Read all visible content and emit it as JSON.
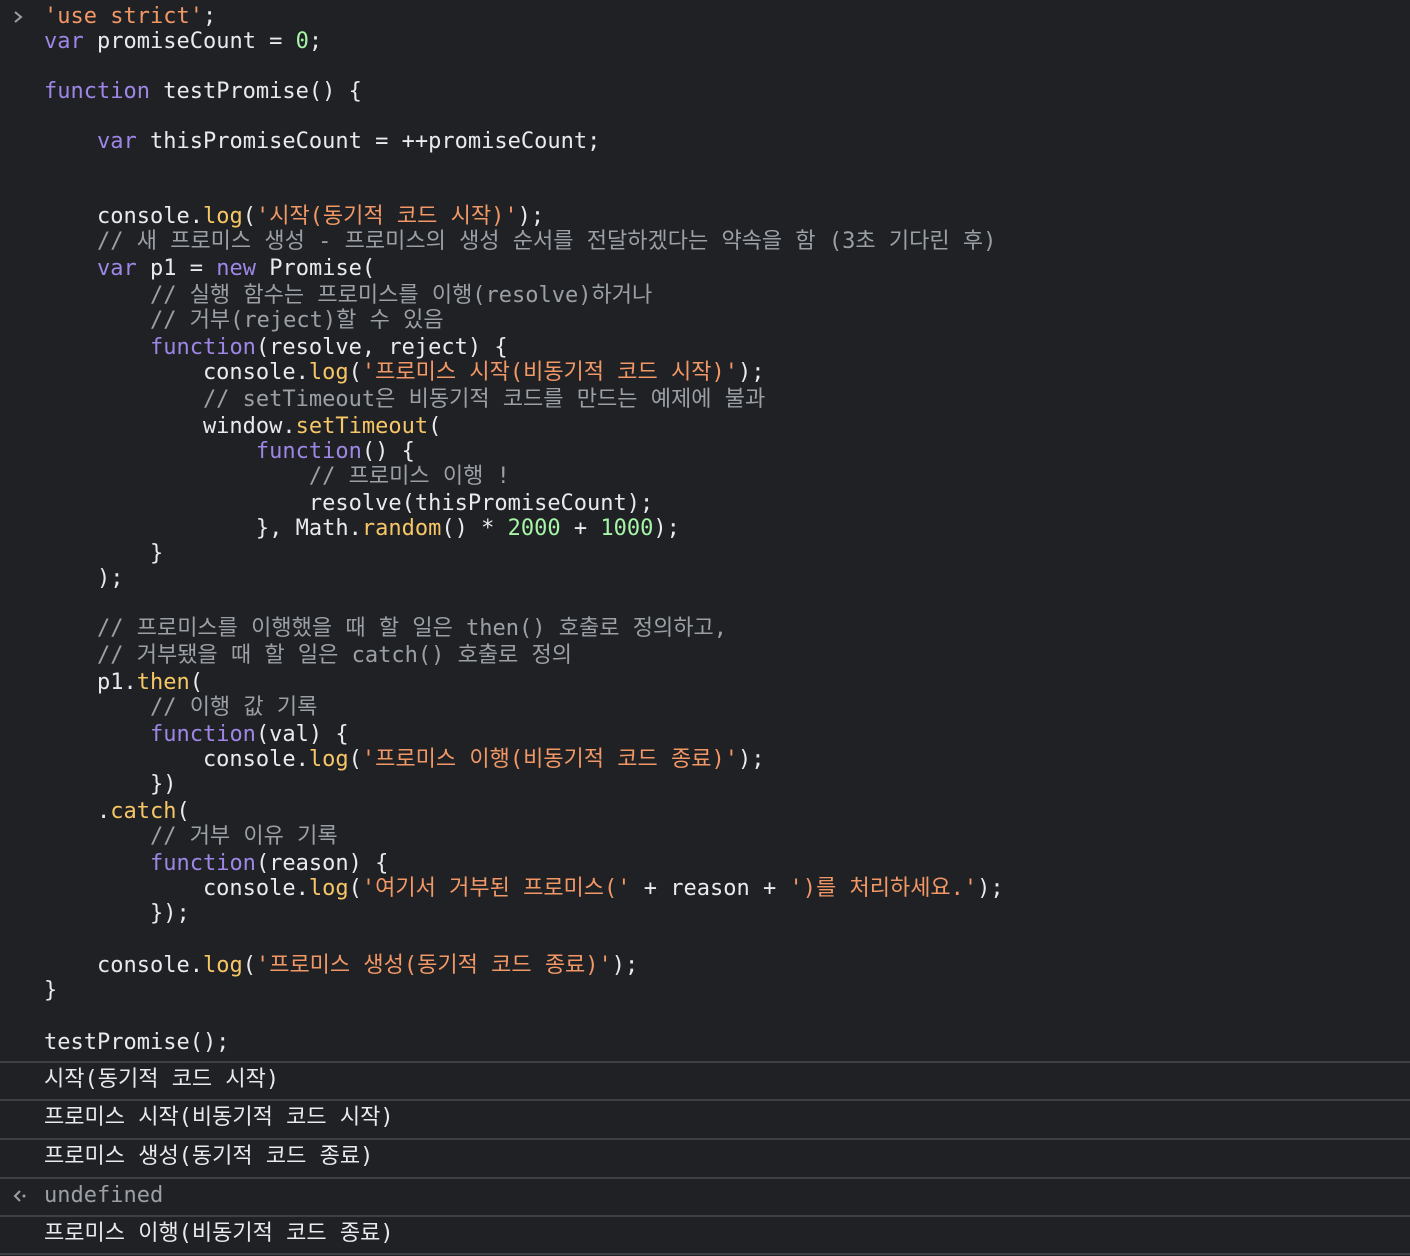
{
  "code_lines": [
    [
      {
        "c": "str",
        "t": "'use strict'"
      },
      {
        "c": "txt",
        "t": ";"
      }
    ],
    [
      {
        "c": "kw",
        "t": "var"
      },
      {
        "c": "txt",
        "t": " promiseCount = "
      },
      {
        "c": "num",
        "t": "0"
      },
      {
        "c": "txt",
        "t": ";"
      }
    ],
    [],
    [
      {
        "c": "kw",
        "t": "function"
      },
      {
        "c": "txt",
        "t": " testPromise() {"
      }
    ],
    [],
    [
      {
        "c": "txt",
        "t": "    "
      },
      {
        "c": "kw",
        "t": "var"
      },
      {
        "c": "txt",
        "t": " thisPromiseCount = ++promiseCount;"
      }
    ],
    [],
    [],
    [
      {
        "c": "txt",
        "t": "    console."
      },
      {
        "c": "fn",
        "t": "log"
      },
      {
        "c": "txt",
        "t": "("
      },
      {
        "c": "str",
        "t": "'시작(동기적 코드 시작)'"
      },
      {
        "c": "txt",
        "t": ");"
      }
    ],
    [
      {
        "c": "cm",
        "t": "    // 새 프로미스 생성 - 프로미스의 생성 순서를 전달하겠다는 약속을 함 (3초 기다린 후)"
      }
    ],
    [
      {
        "c": "txt",
        "t": "    "
      },
      {
        "c": "kw",
        "t": "var"
      },
      {
        "c": "txt",
        "t": " p1 = "
      },
      {
        "c": "kw",
        "t": "new"
      },
      {
        "c": "txt",
        "t": " Promise("
      }
    ],
    [
      {
        "c": "cm",
        "t": "        // 실행 함수는 프로미스를 이행(resolve)하거나"
      }
    ],
    [
      {
        "c": "cm",
        "t": "        // 거부(reject)할 수 있음"
      }
    ],
    [
      {
        "c": "txt",
        "t": "        "
      },
      {
        "c": "kw",
        "t": "function"
      },
      {
        "c": "txt",
        "t": "(resolve, reject) {"
      }
    ],
    [
      {
        "c": "txt",
        "t": "            console."
      },
      {
        "c": "fn",
        "t": "log"
      },
      {
        "c": "txt",
        "t": "("
      },
      {
        "c": "str",
        "t": "'프로미스 시작(비동기적 코드 시작)'"
      },
      {
        "c": "txt",
        "t": ");"
      }
    ],
    [
      {
        "c": "cm",
        "t": "            // setTimeout은 비동기적 코드를 만드는 예제에 불과"
      }
    ],
    [
      {
        "c": "txt",
        "t": "            window."
      },
      {
        "c": "fn",
        "t": "setTimeout"
      },
      {
        "c": "txt",
        "t": "("
      }
    ],
    [
      {
        "c": "txt",
        "t": "                "
      },
      {
        "c": "kw",
        "t": "function"
      },
      {
        "c": "txt",
        "t": "() {"
      }
    ],
    [
      {
        "c": "cm",
        "t": "                    // 프로미스 이행 !"
      }
    ],
    [
      {
        "c": "txt",
        "t": "                    resolve(thisPromiseCount);"
      }
    ],
    [
      {
        "c": "txt",
        "t": "                }, Math."
      },
      {
        "c": "fn",
        "t": "random"
      },
      {
        "c": "txt",
        "t": "() * "
      },
      {
        "c": "num",
        "t": "2000"
      },
      {
        "c": "txt",
        "t": " + "
      },
      {
        "c": "num",
        "t": "1000"
      },
      {
        "c": "txt",
        "t": ");"
      }
    ],
    [
      {
        "c": "txt",
        "t": "        }"
      }
    ],
    [
      {
        "c": "txt",
        "t": "    );"
      }
    ],
    [],
    [
      {
        "c": "cm",
        "t": "    // 프로미스를 이행했을 때 할 일은 then() 호출로 정의하고,"
      }
    ],
    [
      {
        "c": "cm",
        "t": "    // 거부됐을 때 할 일은 catch() 호출로 정의"
      }
    ],
    [
      {
        "c": "txt",
        "t": "    p1."
      },
      {
        "c": "fn",
        "t": "then"
      },
      {
        "c": "txt",
        "t": "("
      }
    ],
    [
      {
        "c": "cm",
        "t": "        // 이행 값 기록"
      }
    ],
    [
      {
        "c": "txt",
        "t": "        "
      },
      {
        "c": "kw",
        "t": "function"
      },
      {
        "c": "txt",
        "t": "(val) {"
      }
    ],
    [
      {
        "c": "txt",
        "t": "            console."
      },
      {
        "c": "fn",
        "t": "log"
      },
      {
        "c": "txt",
        "t": "("
      },
      {
        "c": "str",
        "t": "'프로미스 이행(비동기적 코드 종료)'"
      },
      {
        "c": "txt",
        "t": ");"
      }
    ],
    [
      {
        "c": "txt",
        "t": "        })"
      }
    ],
    [
      {
        "c": "txt",
        "t": "    ."
      },
      {
        "c": "fn",
        "t": "catch"
      },
      {
        "c": "txt",
        "t": "("
      }
    ],
    [
      {
        "c": "cm",
        "t": "        // 거부 이유 기록"
      }
    ],
    [
      {
        "c": "txt",
        "t": "        "
      },
      {
        "c": "kw",
        "t": "function"
      },
      {
        "c": "txt",
        "t": "(reason) {"
      }
    ],
    [
      {
        "c": "txt",
        "t": "            console."
      },
      {
        "c": "fn",
        "t": "log"
      },
      {
        "c": "txt",
        "t": "("
      },
      {
        "c": "str",
        "t": "'여기서 거부된 프로미스('"
      },
      {
        "c": "txt",
        "t": " + reason + "
      },
      {
        "c": "str",
        "t": "')를 처리하세요.'"
      },
      {
        "c": "txt",
        "t": ");"
      }
    ],
    [
      {
        "c": "txt",
        "t": "        });"
      }
    ],
    [],
    [
      {
        "c": "txt",
        "t": "    console."
      },
      {
        "c": "fn",
        "t": "log"
      },
      {
        "c": "txt",
        "t": "("
      },
      {
        "c": "str",
        "t": "'프로미스 생성(동기적 코드 종료)'"
      },
      {
        "c": "txt",
        "t": ");"
      }
    ],
    [
      {
        "c": "txt",
        "t": "}"
      }
    ],
    [],
    [
      {
        "c": "txt",
        "t": "testPromise();"
      }
    ]
  ],
  "outputs": {
    "log1": "시작(동기적 코드 시작)",
    "log2": "프로미스 시작(비동기적 코드 시작)",
    "log3": "프로미스 생성(동기적 코드 종료)",
    "return_value": "undefined",
    "log4": "프로미스 이행(비동기적 코드 종료)"
  },
  "icons": {
    "prompt": "chevron-right-icon",
    "return": "return-arrow-icon"
  },
  "colors": {
    "background": "#202124",
    "keyword": "#9e86e6",
    "string": "#f29766",
    "number": "#a6f4a8",
    "function": "#f6c667",
    "comment": "#9aa0a6",
    "text": "#e8eaed"
  }
}
